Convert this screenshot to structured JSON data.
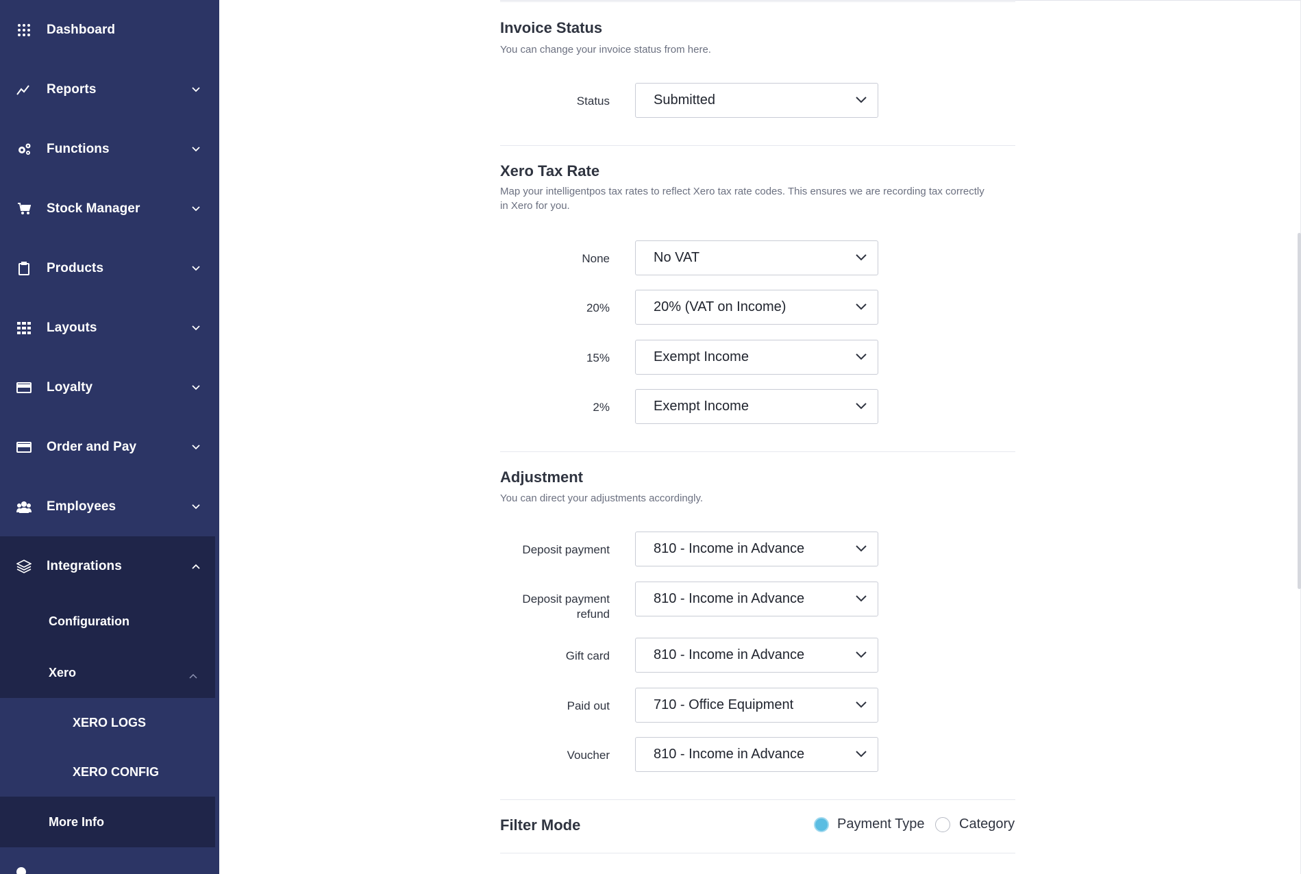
{
  "sidebar": {
    "items": [
      {
        "label": "Dashboard",
        "icon": "grid-dots-icon"
      },
      {
        "label": "Reports",
        "icon": "chart-line-icon"
      },
      {
        "label": "Functions",
        "icon": "gears-icon"
      },
      {
        "label": "Stock Manager",
        "icon": "cart-icon"
      },
      {
        "label": "Products",
        "icon": "clipboard-icon"
      },
      {
        "label": "Layouts",
        "icon": "grid-icon"
      },
      {
        "label": "Loyalty",
        "icon": "card-icon"
      },
      {
        "label": "Order and Pay",
        "icon": "card-icon"
      },
      {
        "label": "Employees",
        "icon": "users-icon"
      },
      {
        "label": "Integrations",
        "icon": "layers-icon"
      }
    ],
    "integrations_sub": {
      "configuration": "Configuration",
      "xero": "Xero",
      "xero_logs": "XERO LOGS",
      "xero_config": "XERO CONFIG",
      "more_info": "More Info"
    }
  },
  "invoice_status": {
    "title": "Invoice Status",
    "description": "You can change your invoice status from here.",
    "status_label": "Status",
    "status_value": "Submitted"
  },
  "xero_tax_rate": {
    "title": "Xero Tax Rate",
    "description": "Map your intelligentpos tax rates to reflect Xero tax rate codes. This ensures we are recording tax correctly in Xero for you.",
    "rows": [
      {
        "label": "None",
        "value": "No VAT"
      },
      {
        "label": "20%",
        "value": "20% (VAT on Income)"
      },
      {
        "label": "15%",
        "value": "Exempt Income"
      },
      {
        "label": "2%",
        "value": "Exempt Income"
      }
    ]
  },
  "adjustment": {
    "title": "Adjustment",
    "description": "You can direct your adjustments accordingly.",
    "rows": [
      {
        "label": "Deposit payment",
        "value": "810 - Income in Advance"
      },
      {
        "label": "Deposit payment refund",
        "value": "810 - Income in Advance"
      },
      {
        "label": "Gift card",
        "value": "810 - Income in Advance"
      },
      {
        "label": "Paid out",
        "value": "710 - Office Equipment"
      },
      {
        "label": "Voucher",
        "value": "810 - Income in Advance"
      }
    ]
  },
  "filter_mode": {
    "title": "Filter Mode",
    "options": [
      "Payment Type",
      "Category"
    ],
    "selected": "Payment Type"
  },
  "colors": {
    "sidebar_bg": "#2c3565",
    "sidebar_sub_bg": "#1f2549",
    "radio_selected": "#5bbde2"
  }
}
